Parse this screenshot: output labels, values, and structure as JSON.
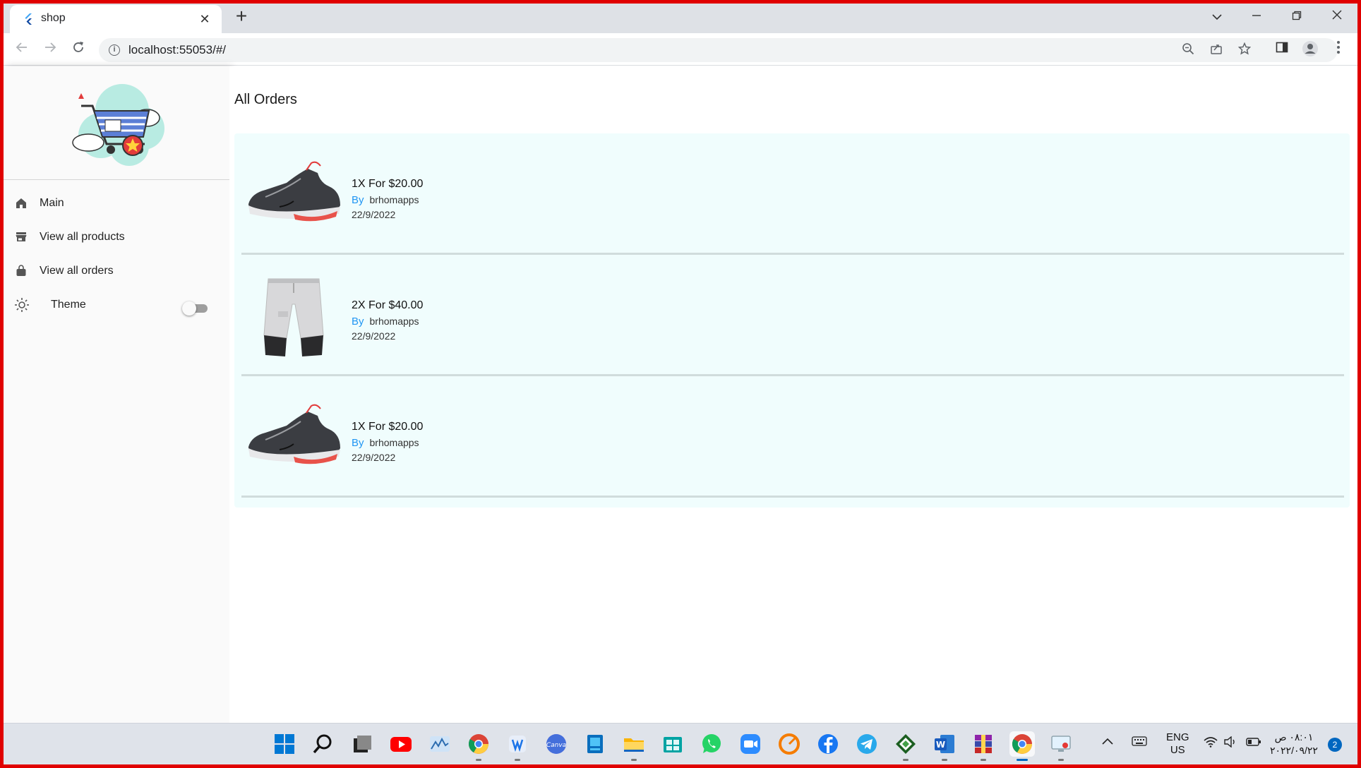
{
  "browser": {
    "tab_title": "shop",
    "url": "localhost:55053/#/",
    "new_tab_symbol": "+",
    "window_controls": [
      "chevron-down-icon",
      "minimize-icon",
      "restore-icon",
      "close-icon"
    ]
  },
  "sidebar": {
    "items": [
      {
        "label": "Main",
        "icon": "home-icon"
      },
      {
        "label": "View all products",
        "icon": "store-icon"
      },
      {
        "label": "View all orders",
        "icon": "bag-icon"
      },
      {
        "label": "Theme",
        "icon": "sun-icon",
        "toggle": false
      }
    ]
  },
  "main": {
    "title": "All Orders",
    "orders": [
      {
        "qty_price": "1X For $20.00",
        "by_label": "By",
        "seller": "brhomapps",
        "date": "22/9/2022",
        "image": "sneaker"
      },
      {
        "qty_price": "2X For $40.00",
        "by_label": "By",
        "seller": "brhomapps",
        "date": "22/9/2022",
        "image": "shorts"
      },
      {
        "qty_price": "1X For $20.00",
        "by_label": "By",
        "seller": "brhomapps",
        "date": "22/9/2022",
        "image": "sneaker"
      }
    ]
  },
  "taskbar": {
    "language": "ENG",
    "region": "US",
    "time": "٠٨:٠١ ص",
    "date": "٢٠٢٢/٠٩/٢٢",
    "notification_count": "2"
  },
  "colors": {
    "accent": "#2196f3",
    "order_card_bg": "#f0fdfd",
    "frame": "#e00000",
    "sidebar_bg": "#fafafa"
  }
}
